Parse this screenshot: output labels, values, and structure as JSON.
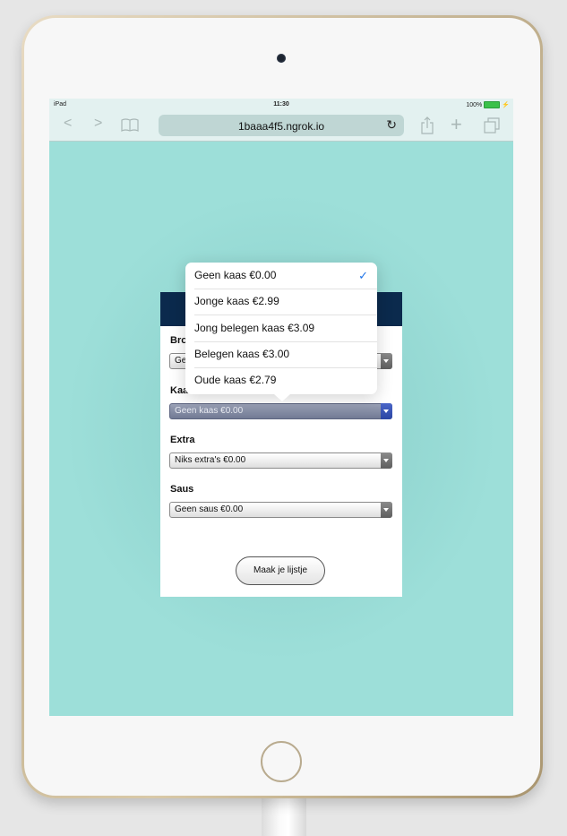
{
  "status_bar": {
    "device": "iPad",
    "time": "11:30",
    "battery": "100%"
  },
  "browser": {
    "url": "1baaa4f5.ngrok.io"
  },
  "form": {
    "bread_label_partial": "Bro",
    "bread_value_partial": "Ge",
    "cheese_label_partial": "Kaa",
    "cheese_value": "Geen kaas €0.00",
    "extra_label": "Extra",
    "extra_value": "Niks extra's €0.00",
    "sauce_label": "Saus",
    "sauce_value": "Geen saus €0.00",
    "submit_label": "Maak je lijstje"
  },
  "dropdown": {
    "options": [
      {
        "label": "Geen kaas €0.00",
        "selected": true
      },
      {
        "label": "Jonge kaas €2.99",
        "selected": false
      },
      {
        "label": "Jong belegen kaas €3.09",
        "selected": false
      },
      {
        "label": "Belegen kaas €3.00",
        "selected": false
      },
      {
        "label": "Oude kaas €2.79",
        "selected": false
      }
    ]
  },
  "colors": {
    "page_background": "#9ddfd9",
    "header": "#0b2a4d",
    "accent": "#1f74e8"
  }
}
